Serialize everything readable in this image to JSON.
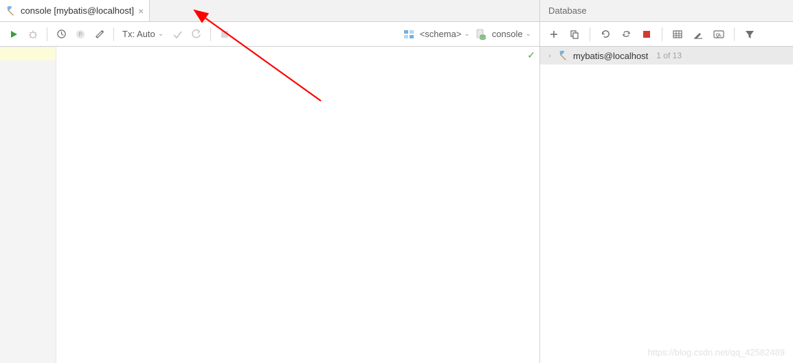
{
  "tab": {
    "label": "console [mybatis@localhost]"
  },
  "toolbar": {
    "tx_label": "Tx: Auto",
    "schema_label": "<schema>",
    "console_label": "console"
  },
  "editor": {
    "status_ok": "✓"
  },
  "db_panel": {
    "title": "Database",
    "tree": {
      "root": {
        "label": "mybatis@localhost",
        "count": "1 of 13"
      }
    }
  },
  "watermark": "https://blog.csdn.net/qq_42582489"
}
